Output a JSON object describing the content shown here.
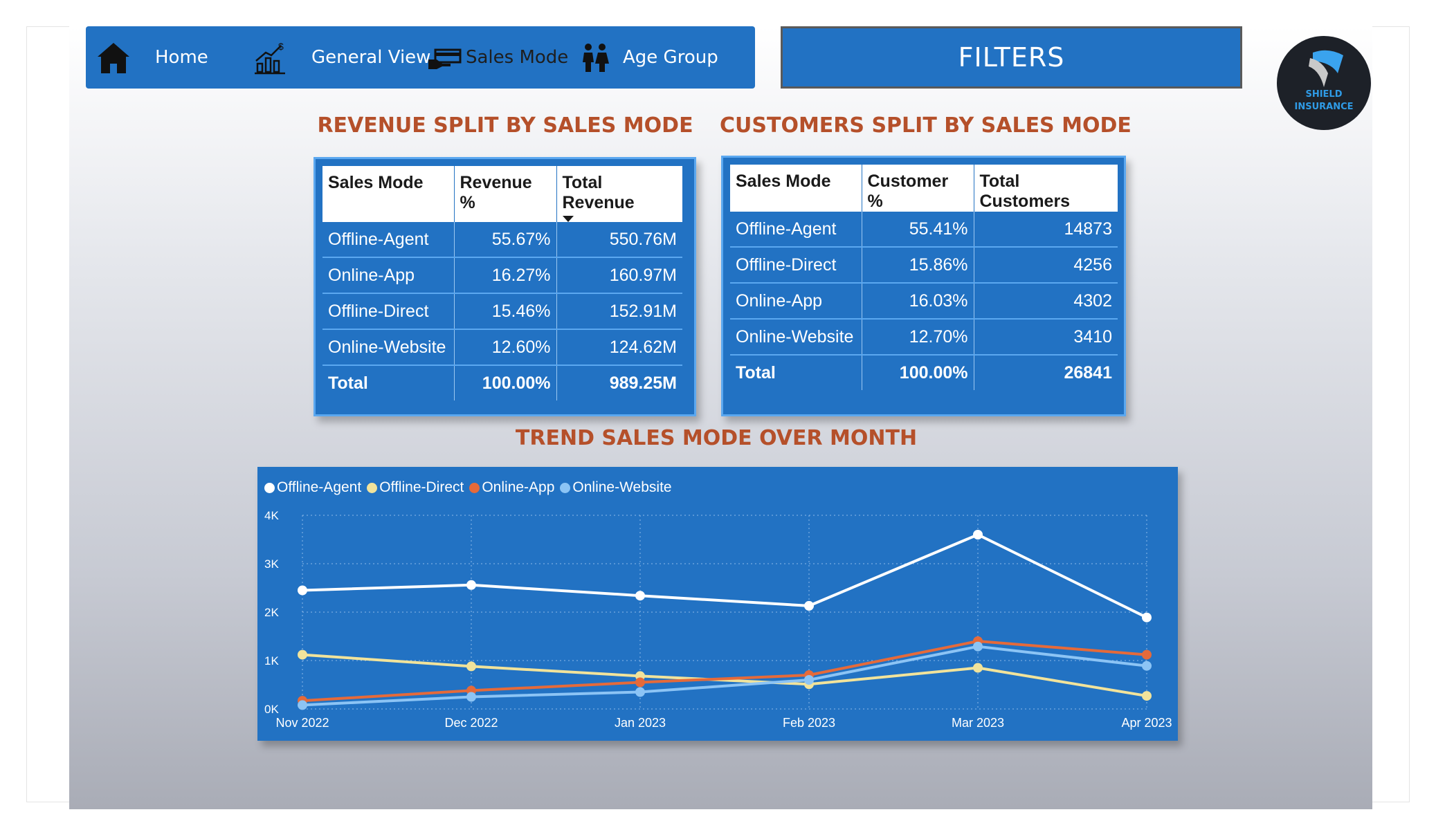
{
  "nav": {
    "items": [
      {
        "label": "Home",
        "icon": "home-icon"
      },
      {
        "label": "General View",
        "icon": "bar-chart-dollar-icon"
      },
      {
        "label": "Sales Mode",
        "icon": "card-hand-icon",
        "active": true
      },
      {
        "label": "Age Group",
        "icon": "people-icon"
      }
    ],
    "filters_label": "FILTERS"
  },
  "logo": {
    "line1": "SHIELD",
    "line2": "INSURANCE"
  },
  "colors": {
    "nav_bg": "#2272c3",
    "title": "#b5502a",
    "offline_agent": "#ffffff",
    "offline_direct": "#f1e39b",
    "online_app": "#e56a3a",
    "online_website": "#8cc4f5"
  },
  "revenue_table": {
    "title": "REVENUE SPLIT BY SALES MODE",
    "headers": [
      "Sales Mode",
      "Revenue %",
      "Total Revenue"
    ],
    "rows": [
      [
        "Offline-Agent",
        "55.67%",
        "550.76M"
      ],
      [
        "Online-App",
        "16.27%",
        "160.97M"
      ],
      [
        "Offline-Direct",
        "15.46%",
        "152.91M"
      ],
      [
        "Online-Website",
        "12.60%",
        "124.62M"
      ]
    ],
    "total": [
      "Total",
      "100.00%",
      "989.25M"
    ]
  },
  "customers_table": {
    "title": "CUSTOMERS SPLIT BY SALES MODE",
    "headers": [
      "Sales Mode",
      "Customer %",
      "Total Customers"
    ],
    "rows": [
      [
        "Offline-Agent",
        "55.41%",
        "14873"
      ],
      [
        "Offline-Direct",
        "15.86%",
        "4256"
      ],
      [
        "Online-App",
        "16.03%",
        "4302"
      ],
      [
        "Online-Website",
        "12.70%",
        "3410"
      ]
    ],
    "total": [
      "Total",
      "100.00%",
      "26841"
    ]
  },
  "chart_data": {
    "type": "line",
    "title": "TREND SALES MODE OVER MONTH",
    "categories": [
      "Nov 2022",
      "Dec 2022",
      "Jan 2023",
      "Feb 2023",
      "Mar 2023",
      "Apr 2023"
    ],
    "y_ticks": [
      "0K",
      "1K",
      "2K",
      "3K",
      "4K"
    ],
    "ylim": [
      0,
      4000
    ],
    "grid": true,
    "legend_position": "top-left",
    "series": [
      {
        "name": "Offline-Agent",
        "color": "#ffffff",
        "values": [
          2450,
          2560,
          2340,
          2130,
          3600,
          1890
        ]
      },
      {
        "name": "Offline-Direct",
        "color": "#f1e39b",
        "values": [
          1120,
          880,
          680,
          510,
          850,
          270
        ]
      },
      {
        "name": "Online-App",
        "color": "#e56a3a",
        "values": [
          170,
          380,
          550,
          700,
          1400,
          1120
        ]
      },
      {
        "name": "Online-Website",
        "color": "#8cc4f5",
        "values": [
          80,
          250,
          350,
          600,
          1290,
          890
        ]
      }
    ]
  }
}
